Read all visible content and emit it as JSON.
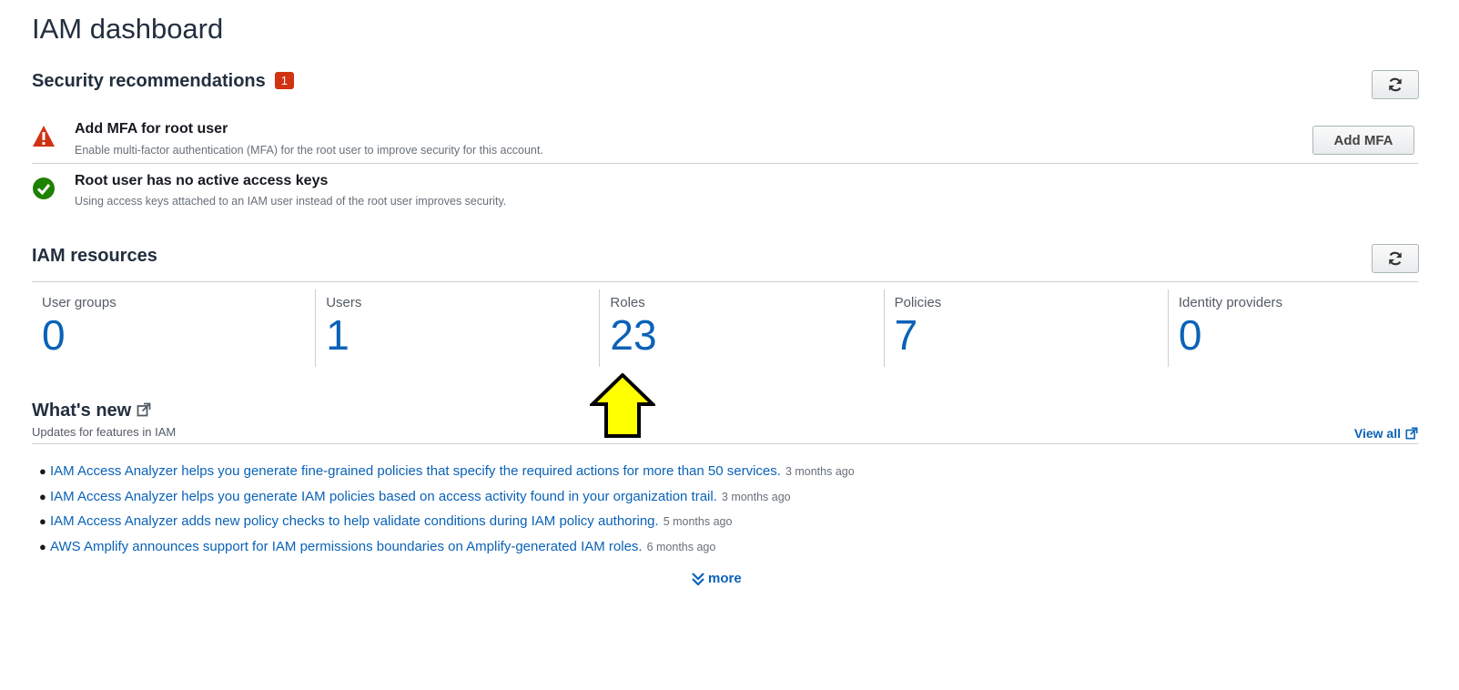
{
  "page_title": "IAM dashboard",
  "security": {
    "title": "Security recommendations",
    "badge_count": "1",
    "refresh_icon": "refresh-icon",
    "items": [
      {
        "title": "Add MFA for root user",
        "description": "Enable multi-factor authentication (MFA) for the root user to improve security for this account.",
        "status": "warning",
        "status_color": "#d13212",
        "action_label": "Add MFA"
      },
      {
        "title": "Root user has no active access keys",
        "description": "Using access keys attached to an IAM user instead of the root user improves security.",
        "status": "success",
        "status_color": "#1d8102"
      }
    ]
  },
  "resources": {
    "title": "IAM resources",
    "items": [
      {
        "label": "User groups",
        "value": "0"
      },
      {
        "label": "Users",
        "value": "1"
      },
      {
        "label": "Roles",
        "value": "23"
      },
      {
        "label": "Policies",
        "value": "7"
      },
      {
        "label": "Identity providers",
        "value": "0"
      }
    ]
  },
  "whats_new": {
    "title": "What's new",
    "subtitle": "Updates for features in IAM",
    "view_all_label": "View all",
    "items": [
      {
        "text": "IAM Access Analyzer helps you generate fine-grained policies that specify the required actions for more than 50 services.",
        "time": "3 months ago"
      },
      {
        "text": "IAM Access Analyzer helps you generate IAM policies based on access activity found in your organization trail.",
        "time": "3 months ago"
      },
      {
        "text": "IAM Access Analyzer adds new policy checks to help validate conditions during IAM policy authoring.",
        "time": "5 months ago"
      },
      {
        "text": "AWS Amplify announces support for IAM permissions boundaries on Amplify-generated IAM roles.",
        "time": "6 months ago"
      }
    ],
    "more_label": "more"
  },
  "colors": {
    "link": "#0a62b7",
    "badge": "#d13212",
    "annotation_arrow": "#ffff00"
  }
}
